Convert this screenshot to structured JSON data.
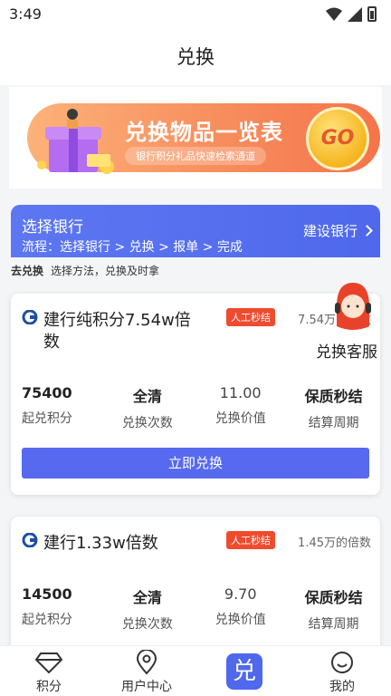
{
  "status": {
    "time": "3:49"
  },
  "header": {
    "title": "兑换"
  },
  "banner": {
    "title": "兑换物品一览表",
    "subtitle": "银行积分礼品快速检索通道",
    "go": "GO"
  },
  "bank_bar": {
    "title": "选择银行",
    "flow": "流程：选择银行 > 兑换 > 报单 > 完成",
    "bank": "建设银行"
  },
  "hint": {
    "strong": "去兑换",
    "text": "选择方法，兑换及时拿"
  },
  "service": {
    "label": "兑换客服"
  },
  "stat_labels": {
    "min_points": "起兑积分",
    "times": "兑换次数",
    "value": "兑换价值",
    "period": "结算周期"
  },
  "cards": [
    {
      "name": "建行纯积分7.54w倍数",
      "tag": "人工秒结",
      "multiple": "7.54万的倍数",
      "min_points": "75400",
      "times": "全清",
      "value": "11.00",
      "period": "保质秒结",
      "button": "立即兑换"
    },
    {
      "name": "建行1.33w倍数",
      "tag": "人工秒结",
      "multiple": "1.45万的倍数",
      "min_points": "14500",
      "times": "全清",
      "value": "9.70",
      "period": "保质秒结"
    }
  ],
  "tabbar": {
    "items": [
      {
        "label": "积分",
        "icon": "diamond-icon"
      },
      {
        "label": "用户中心",
        "icon": "location-pin-icon"
      },
      {
        "label": "兑",
        "icon": "exchange-icon"
      },
      {
        "label": "我的",
        "icon": "smile-icon"
      }
    ]
  },
  "colors": {
    "primary": "#4f68ec",
    "tag": "#ef4b2f",
    "banner": "#f78d5d"
  }
}
